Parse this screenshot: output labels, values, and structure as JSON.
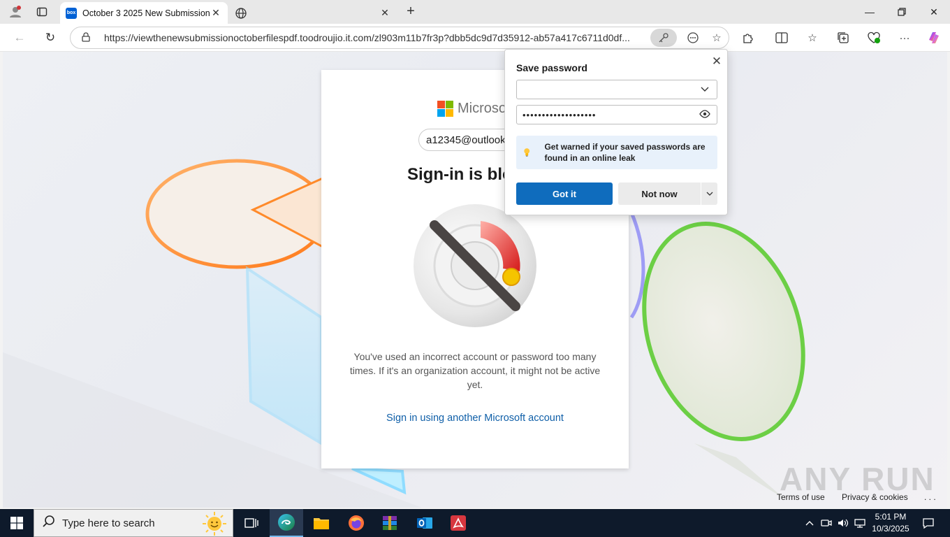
{
  "browser": {
    "tabs": [
      {
        "title": "October 3 2025 New Submission",
        "favicon": "box"
      },
      {
        "title": ""
      }
    ],
    "address": {
      "url": "https://viewthenewsubmissionoctoberfilespdf.toodroujio.it.com/zl903m11b7fr3p?dbb5dc9d7d35912-ab57a417c6711d0df..."
    }
  },
  "page": {
    "brand": "Microsoft",
    "email": "a12345@outlook.com",
    "heading": "Sign-in is blocked",
    "message": "You've used an incorrect account or password too many times. If it's an organization account, it might not be active yet.",
    "alt_link": "Sign in using another Microsoft account",
    "footer": {
      "terms": "Terms of use",
      "privacy": "Privacy & cookies",
      "more": ". . ."
    },
    "watermark": "ANY RUN"
  },
  "save_password": {
    "title": "Save password",
    "username_value": "",
    "password_value": "•••••••••••••••••••",
    "info": "Get warned if your saved passwords are found in an online leak",
    "primary_button": "Got it",
    "secondary_button": "Not now"
  },
  "taskbar": {
    "search_placeholder": "Type here to search",
    "time": "5:01 PM",
    "date": "10/3/2025"
  },
  "colors": {
    "accent": "#0f6cbd",
    "link": "#0f5fa8",
    "taskbar": "#0e1a2b",
    "ms_red": "#f25022",
    "ms_green": "#7fba00",
    "ms_blue": "#00a4ef",
    "ms_yellow": "#ffb900"
  }
}
